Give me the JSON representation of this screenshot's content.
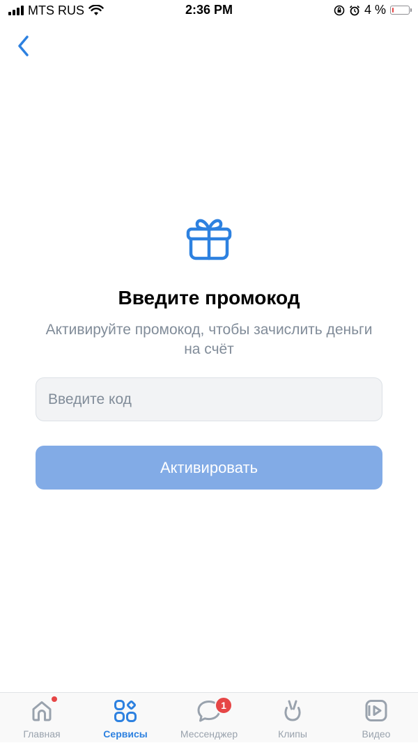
{
  "status_bar": {
    "carrier": "MTS RUS",
    "time": "2:36 PM",
    "battery_percent": "4 %",
    "battery_level": 0.04,
    "battery_color": "#e64646"
  },
  "header": {
    "back_icon": "chevron-left-icon"
  },
  "promo": {
    "icon": "gift-icon",
    "title": "Введите промокод",
    "subtitle": "Активируйте промокод, чтобы зачислить деньги на счёт",
    "input_value": "",
    "input_placeholder": "Введите код",
    "button_label": "Активировать"
  },
  "tab_bar": {
    "tabs": [
      {
        "label": "Главная",
        "icon": "home-icon",
        "active": false,
        "dot": true
      },
      {
        "label": "Сервисы",
        "icon": "services-icon",
        "active": true
      },
      {
        "label": "Мессенджер",
        "icon": "messenger-icon",
        "active": false,
        "badge": "1"
      },
      {
        "label": "Клипы",
        "icon": "clips-icon",
        "active": false
      },
      {
        "label": "Видео",
        "icon": "video-icon",
        "active": false
      }
    ]
  },
  "colors": {
    "accent": "#2d81e0",
    "button_disabled": "#82abe6",
    "secondary_text": "#818c99",
    "badge": "#e64646"
  }
}
